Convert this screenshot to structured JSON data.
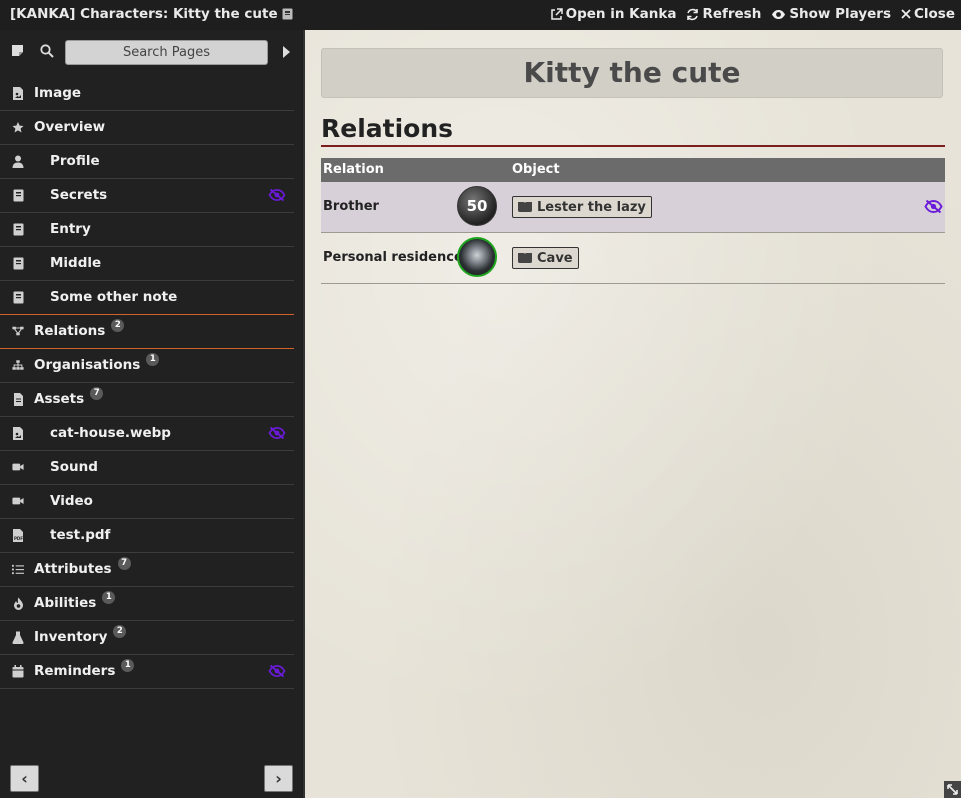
{
  "window": {
    "title": "[KANKA] Characters: Kitty the cute",
    "actions": {
      "open": "Open in Kanka",
      "refresh": "Refresh",
      "show_players": "Show Players",
      "close": "Close"
    }
  },
  "sidebar": {
    "search_placeholder": "Search Pages",
    "items": [
      {
        "label": "Image",
        "icon": "file-image-icon",
        "indent": false
      },
      {
        "label": "Overview",
        "icon": "star-icon",
        "indent": false
      },
      {
        "label": "Profile",
        "icon": "user-icon",
        "indent": true
      },
      {
        "label": "Secrets",
        "icon": "book-icon",
        "indent": true,
        "hidden": true
      },
      {
        "label": "Entry",
        "icon": "book-icon",
        "indent": true
      },
      {
        "label": "Middle",
        "icon": "book-icon",
        "indent": true
      },
      {
        "label": "Some other note",
        "icon": "book-icon",
        "indent": true
      },
      {
        "label": "Relations",
        "icon": "share-nodes-icon",
        "indent": false,
        "badge": "2",
        "active": true
      },
      {
        "label": "Organisations",
        "icon": "sitemap-icon",
        "indent": false,
        "badge": "1"
      },
      {
        "label": "Assets",
        "icon": "file-icon",
        "indent": false,
        "badge": "7"
      },
      {
        "label": "cat-house.webp",
        "icon": "file-image-icon",
        "indent": true,
        "hidden": true
      },
      {
        "label": "Sound",
        "icon": "video-icon",
        "indent": true
      },
      {
        "label": "Video",
        "icon": "video-icon",
        "indent": true
      },
      {
        "label": "test.pdf",
        "icon": "file-pdf-icon",
        "indent": true
      },
      {
        "label": "Attributes",
        "icon": "list-icon",
        "indent": false,
        "badge": "7"
      },
      {
        "label": "Abilities",
        "icon": "fire-icon",
        "indent": false,
        "badge": "1"
      },
      {
        "label": "Inventory",
        "icon": "flask-icon",
        "indent": false,
        "badge": "2"
      },
      {
        "label": "Reminders",
        "icon": "calendar-icon",
        "indent": false,
        "badge": "1",
        "hidden": true
      }
    ]
  },
  "main": {
    "page_title": "Kitty the cute",
    "section_title": "Relations",
    "table": {
      "headers": {
        "relation": "Relation",
        "object": "Object"
      },
      "rows": [
        {
          "relation": "Brother",
          "avatar_text": "50",
          "object": "Lester the lazy",
          "hidden": true
        },
        {
          "relation": "Personal residence",
          "avatar_text": "",
          "object": "Cave",
          "hidden": false
        }
      ]
    }
  },
  "colors": {
    "accent": "#d2622a",
    "hidden_icon": "#6a1bd8",
    "section_rule": "#7a1e1e",
    "avatar_ring": "#1ea41e"
  }
}
